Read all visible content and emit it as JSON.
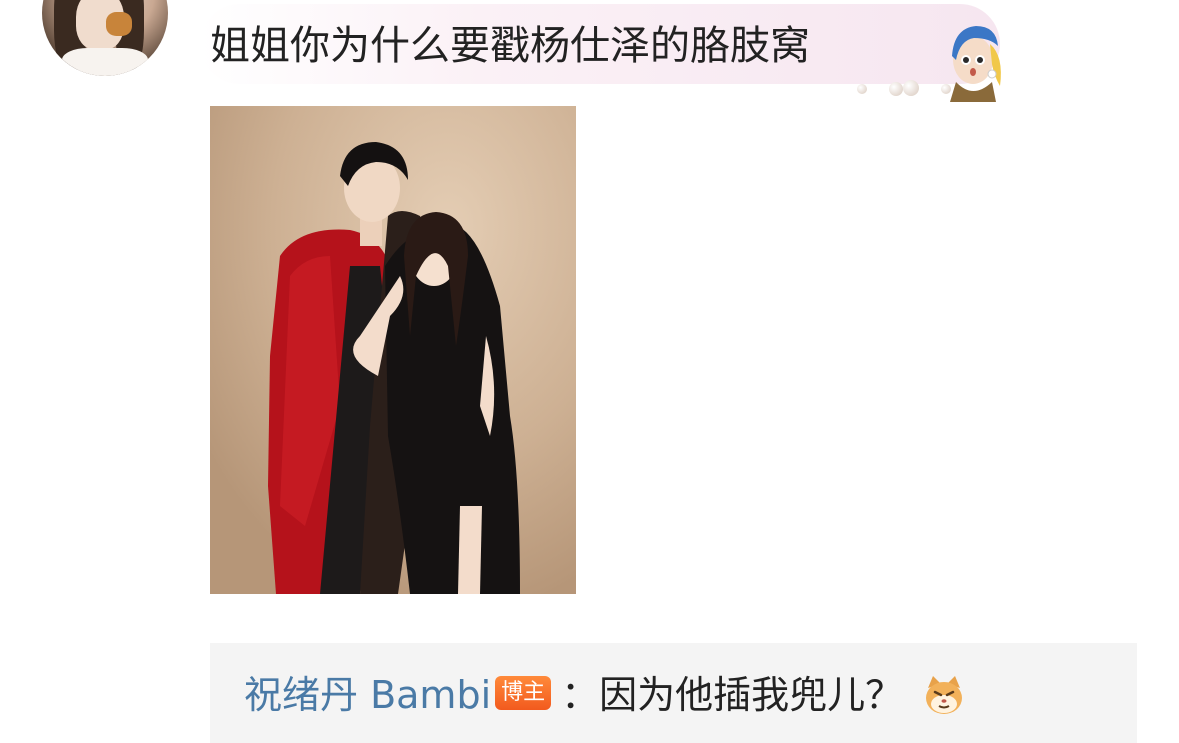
{
  "comment": {
    "text": "姐姐你为什么要戳杨仕泽的胳肢窝",
    "sticker": "pearl-earring-girl-sticker",
    "image": "couple-photo"
  },
  "reply": {
    "author": "祝绪丹 Bambi",
    "badge": "博主",
    "text": "：因为他插我兜儿？",
    "emoji": "cat-face-emoji"
  },
  "colors": {
    "reply_name": "#4a7aa6",
    "badge_bg": "#f25a1e",
    "reply_box_bg": "#f4f4f4",
    "bubble_bg": "#f6e6f0"
  }
}
